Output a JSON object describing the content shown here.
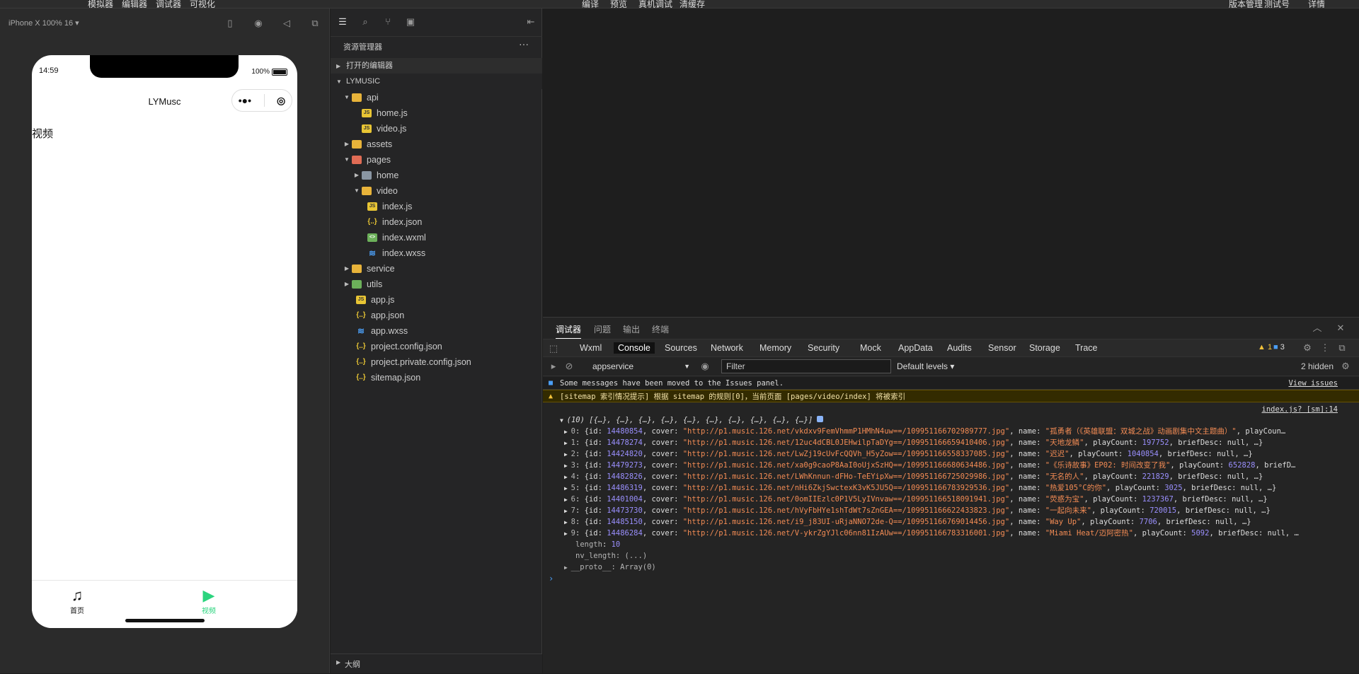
{
  "topbar": {
    "menu": [
      "模拟器",
      "编辑器",
      "调试器",
      "可视化"
    ],
    "center": [
      "编译",
      "预览",
      "真机调试",
      "清缓存"
    ],
    "right": [
      "版本管理",
      "测试号",
      "详情"
    ]
  },
  "simulator": {
    "device": "iPhone X 100% 16 ▾",
    "phone": {
      "time": "14:59",
      "battery": "100%",
      "title": "LYMusc",
      "content": "视频",
      "tabs": [
        {
          "label": "首页",
          "icon": "♫",
          "color": "#111111"
        },
        {
          "label": "视频",
          "icon": "▶",
          "color": "#2bd47e"
        }
      ]
    }
  },
  "explorer": {
    "header": "资源管理器",
    "open_editors": "打开的编辑器",
    "project": "LYMUSIC",
    "tree": [
      {
        "label": "api",
        "type": "folder",
        "open": true
      },
      {
        "label": "home.js",
        "type": "js"
      },
      {
        "label": "video.js",
        "type": "js"
      },
      {
        "label": "assets",
        "type": "folder"
      },
      {
        "label": "pages",
        "type": "folder-red",
        "open": true
      },
      {
        "label": "home",
        "type": "folder-grey"
      },
      {
        "label": "video",
        "type": "folder",
        "open": true
      },
      {
        "label": "index.js",
        "type": "js"
      },
      {
        "label": "index.json",
        "type": "json"
      },
      {
        "label": "index.wxml",
        "type": "wxml"
      },
      {
        "label": "index.wxss",
        "type": "wxss"
      },
      {
        "label": "service",
        "type": "folder"
      },
      {
        "label": "utils",
        "type": "folder-green"
      },
      {
        "label": "app.js",
        "type": "js"
      },
      {
        "label": "app.json",
        "type": "json"
      },
      {
        "label": "app.wxss",
        "type": "wxss"
      },
      {
        "label": "project.config.json",
        "type": "json"
      },
      {
        "label": "project.private.config.json",
        "type": "json"
      },
      {
        "label": "sitemap.json",
        "type": "json"
      }
    ],
    "outline": "大纲"
  },
  "devtools": {
    "top_tabs": [
      "调试器",
      "问题",
      "输出",
      "终端"
    ],
    "panel_tabs": [
      "Wxml",
      "Console",
      "Sources",
      "Network",
      "Memory",
      "Security",
      "Mock",
      "AppData",
      "Audits",
      "Sensor",
      "Storage",
      "Trace"
    ],
    "active_panel": "Console",
    "warnings": "1",
    "messages": "3",
    "context": "appservice",
    "filter_placeholder": "Filter",
    "levels": "Default levels ▾",
    "hidden": "2 hidden",
    "info_msg": "Some messages have been moved to the Issues panel.",
    "view_issues": "View issues",
    "warn_msg": "[sitemap 索引情况提示] 根据 sitemap 的规则[0]，当前页面 [pages/video/index] 将被索引",
    "source": "index.js? [sm]:14",
    "array_summary": "(10) [{…}, {…}, {…}, {…}, {…}, {…}, {…}, {…}, {…}, {…}]",
    "items": [
      {
        "i": "0",
        "id": "14480854",
        "cover": "\"http://p1.music.126.net/vkdxv9FemVhmmP1HMhN4uw==/109951166702989777.jpg\"",
        "name": "\"孤勇者（《英雄联盟：双城之战》动画剧集中文主题曲）\"",
        "rest": ", playCoun…"
      },
      {
        "i": "1",
        "id": "14478274",
        "cover": "\"http://p1.music.126.net/12uc4dCBL0JEHwilpTaDYg==/109951166659410406.jpg\"",
        "name": "\"天地龙鳞\"",
        "playCount": "197752",
        "rest": ", briefDesc: null, …}"
      },
      {
        "i": "2",
        "id": "14424820",
        "cover": "\"http://p1.music.126.net/LwZj19cUvFcQQVh_H5yZow==/109951166558337085.jpg\"",
        "name": "\"迟迟\"",
        "playCount": "1040854",
        "rest": ", briefDesc: null, …}"
      },
      {
        "i": "3",
        "id": "14479273",
        "cover": "\"http://p1.music.126.net/xa0g9caoP8AaI0oUjxSzHQ==/109951166680634486.jpg\"",
        "name": "\"《乐诗故事》EP02: 时间改变了我\"",
        "playCount": "652828",
        "rest": ", briefD…"
      },
      {
        "i": "4",
        "id": "14482826",
        "cover": "\"http://p1.music.126.net/LWhKnnun-dFHo-TeEYipXw==/109951166725029986.jpg\"",
        "name": "\"无名的人\"",
        "playCount": "221829",
        "rest": ", briefDesc: null, …}"
      },
      {
        "i": "5",
        "id": "14486319",
        "cover": "\"http://p1.music.126.net/nHi6ZkjSwctexK3vK5JU5Q==/109951166783929536.jpg\"",
        "name": "\"热爱105°C的你\"",
        "playCount": "3025",
        "rest": ", briefDesc: null, …}"
      },
      {
        "i": "6",
        "id": "14401004",
        "cover": "\"http://p1.music.126.net/0omIIEzlc0P1V5LyIVnvaw==/109951166518091941.jpg\"",
        "name": "\"荧惑为宝\"",
        "playCount": "1237367",
        "rest": ", briefDesc: null, …}"
      },
      {
        "i": "7",
        "id": "14473730",
        "cover": "\"http://p1.music.126.net/hVyFbHYe1shTdWt7sZnGEA==/109951166622433823.jpg\"",
        "name": "\"一起向未来\"",
        "playCount": "720015",
        "rest": ", briefDesc: null, …}"
      },
      {
        "i": "8",
        "id": "14485150",
        "cover": "\"http://p1.music.126.net/i9_j83UI-uRjaNNO72de-Q==/109951166769014456.jpg\"",
        "name": "\"Way Up\"",
        "playCount": "7706",
        "rest": ", briefDesc: null, …}"
      },
      {
        "i": "9",
        "id": "14486284",
        "cover": "\"http://p1.music.126.net/V-ykrZgYJlc06nn81IzAUw==/109951166783316001.jpg\"",
        "name": "\"Miami Heat/迈阿密热\"",
        "playCount": "5092",
        "rest": ", briefDesc: null, …"
      }
    ],
    "length_label": "length",
    "length_value": "10",
    "nv_length": "nv_length: (...)",
    "proto": "__proto__: Array(0)"
  }
}
